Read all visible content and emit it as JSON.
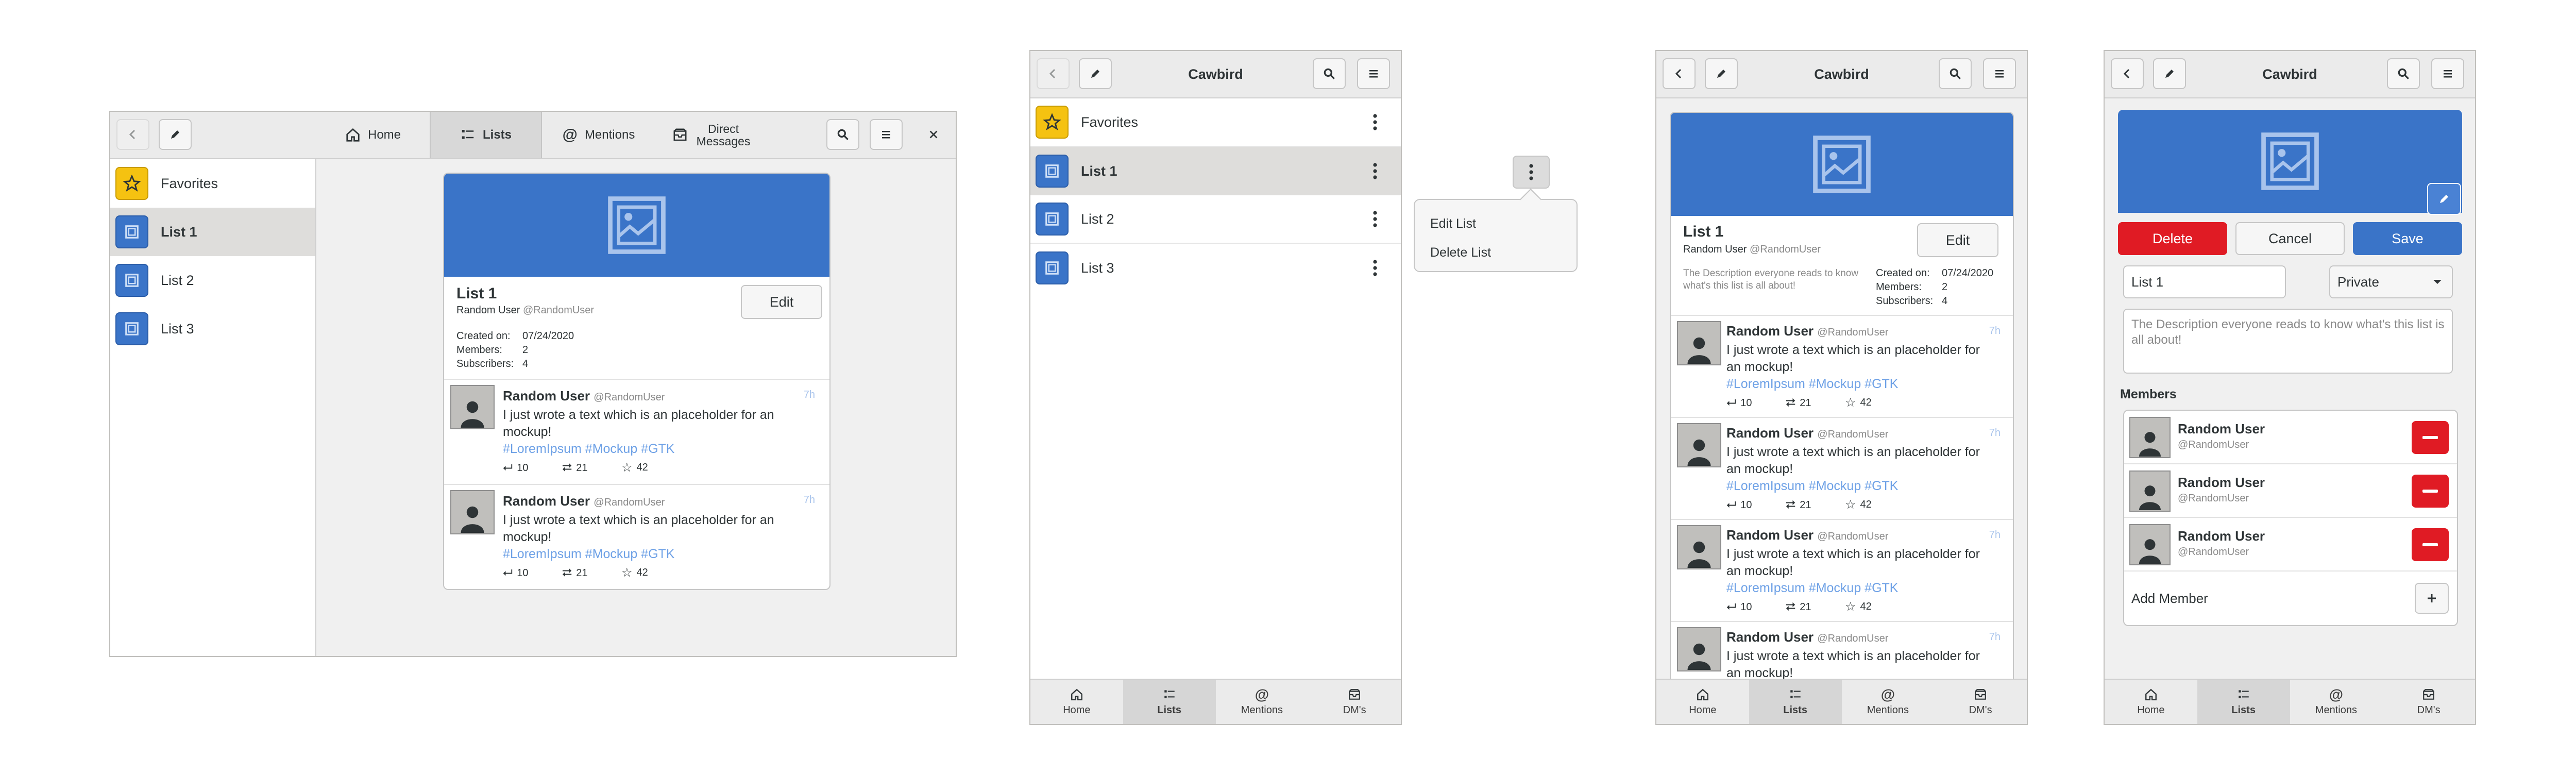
{
  "colors": {
    "accent": "#3a74c8",
    "favorites": "#f5c211",
    "destructive": "#e01b24",
    "hashtag": "#6ea1e6"
  },
  "app": {
    "title": "Cawbird"
  },
  "nav": {
    "home": "Home",
    "lists": "Lists",
    "mentions": "Mentions",
    "direct_messages": "Direct Messages",
    "dms": "DM's"
  },
  "sidebar": {
    "items": [
      {
        "label": "Favorites",
        "icon": "star-icon"
      },
      {
        "label": "List 1",
        "icon": "image-icon"
      },
      {
        "label": "List 2",
        "icon": "image-icon"
      },
      {
        "label": "List 3",
        "icon": "image-icon"
      }
    ]
  },
  "list": {
    "name": "List 1",
    "owner_name": "Random User",
    "owner_handle": "@RandomUser",
    "created_label": "Created on:",
    "created_value": "07/24/2020",
    "members_label": "Members:",
    "members_value": "2",
    "subscribers_label": "Subscribers:",
    "subscribers_value": "4",
    "edit_label": "Edit",
    "description": "The Description everyone reads to know what's this list is all about!"
  },
  "tweet": {
    "name": "Random User",
    "handle": "@RandomUser",
    "time": "7h",
    "text": "I just wrote a text which is an placeholder for an mockup!",
    "hashtags": "#LoremIpsum #Mockup #GTK",
    "replies": "10",
    "retweets": "21",
    "likes": "42"
  },
  "popover": {
    "edit": "Edit List",
    "delete": "Delete List"
  },
  "editor": {
    "delete_label": "Delete",
    "cancel_label": "Cancel",
    "save_label": "Save",
    "name_value": "List 1",
    "privacy_value": "Private",
    "description_value": "The Description everyone reads to know what's this list is all about!",
    "members_heading": "Members",
    "member_name": "Random User",
    "member_handle": "@RandomUser",
    "add_member_label": "Add Member"
  }
}
